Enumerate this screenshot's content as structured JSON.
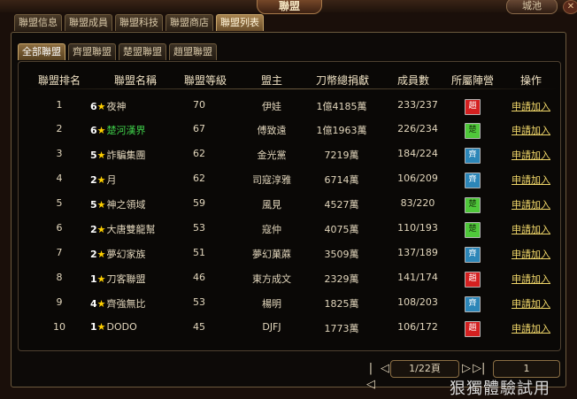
{
  "window": {
    "title": "聯盟",
    "city_button": "城池"
  },
  "main_tabs": [
    {
      "label": "聯盟信息",
      "active": false
    },
    {
      "label": "聯盟成員",
      "active": false
    },
    {
      "label": "聯盟科技",
      "active": false
    },
    {
      "label": "聯盟商店",
      "active": false
    },
    {
      "label": "聯盟列表",
      "active": true
    }
  ],
  "sub_tabs": [
    {
      "label": "全部聯盟",
      "active": true
    },
    {
      "label": "齊盟聯盟",
      "active": false
    },
    {
      "label": "楚盟聯盟",
      "active": false
    },
    {
      "label": "趙盟聯盟",
      "active": false
    }
  ],
  "table": {
    "headers": [
      "聯盟排名",
      "聯盟名稱",
      "聯盟等級",
      "盟主",
      "刀幣總捐獻",
      "成員數",
      "所屬陣營",
      "操作"
    ],
    "rows": [
      {
        "rank": "1",
        "level": "6",
        "name": "夜神",
        "name_color": "default",
        "alliance_level": "70",
        "leader": "伊娃",
        "donation": "1億4185萬",
        "members": "233/237",
        "faction": "趙",
        "faction_color": "red",
        "action": "申請加入"
      },
      {
        "rank": "2",
        "level": "6",
        "name": "楚河漢界",
        "name_color": "green",
        "alliance_level": "67",
        "leader": "傅致遠",
        "donation": "1億1963萬",
        "members": "226/234",
        "faction": "楚",
        "faction_color": "green",
        "action": "申請加入"
      },
      {
        "rank": "3",
        "level": "5",
        "name": "詐騙集團",
        "name_color": "default",
        "alliance_level": "62",
        "leader": "金光黨",
        "donation": "7219萬",
        "members": "184/224",
        "faction": "齊",
        "faction_color": "blue",
        "action": "申請加入"
      },
      {
        "rank": "4",
        "level": "2",
        "name": "月",
        "name_color": "default",
        "alliance_level": "62",
        "leader": "司寇淳雅",
        "donation": "6714萬",
        "members": "106/209",
        "faction": "齊",
        "faction_color": "blue",
        "action": "申請加入"
      },
      {
        "rank": "5",
        "level": "5",
        "name": "神之領域",
        "name_color": "default",
        "alliance_level": "59",
        "leader": "風見",
        "donation": "4527萬",
        "members": "83/220",
        "faction": "楚",
        "faction_color": "green",
        "action": "申請加入"
      },
      {
        "rank": "6",
        "level": "2",
        "name": "大唐雙龍幫",
        "name_color": "default",
        "alliance_level": "53",
        "leader": "寇仲",
        "donation": "4075萬",
        "members": "110/193",
        "faction": "楚",
        "faction_color": "green",
        "action": "申請加入"
      },
      {
        "rank": "7",
        "level": "2",
        "name": "夢幻家族",
        "name_color": "default",
        "alliance_level": "51",
        "leader": "夢幻菓蔴",
        "donation": "3509萬",
        "members": "137/189",
        "faction": "齊",
        "faction_color": "blue",
        "action": "申請加入"
      },
      {
        "rank": "8",
        "level": "1",
        "name": "刀客聯盟",
        "name_color": "default",
        "alliance_level": "46",
        "leader": "東方成文",
        "donation": "2329萬",
        "members": "141/174",
        "faction": "趙",
        "faction_color": "red",
        "action": "申請加入"
      },
      {
        "rank": "9",
        "level": "4",
        "name": "齊強無比",
        "name_color": "default",
        "alliance_level": "53",
        "leader": "楊明",
        "donation": "1825萬",
        "members": "108/203",
        "faction": "齊",
        "faction_color": "blue",
        "action": "申請加入"
      },
      {
        "rank": "10",
        "level": "1",
        "name": "DODO",
        "name_color": "default",
        "alliance_level": "45",
        "leader": "DJFJ",
        "donation": "1773萬",
        "members": "106/172",
        "faction": "趙",
        "faction_color": "red",
        "action": "申請加入"
      }
    ]
  },
  "pagination": {
    "page_info": "1/22頁",
    "page_input": "1"
  },
  "watermark": "狠獨體驗試用",
  "icons": {
    "star": "star-icon",
    "first": "first-page-icon",
    "prev": "prev-page-icon",
    "next": "next-page-icon",
    "last": "last-page-icon"
  },
  "colors": {
    "faction_red": "#d42020",
    "faction_green": "#4fc83a",
    "faction_blue": "#2c86b8",
    "join_link": "#f2d86a",
    "green_name": "#3fd04a"
  }
}
